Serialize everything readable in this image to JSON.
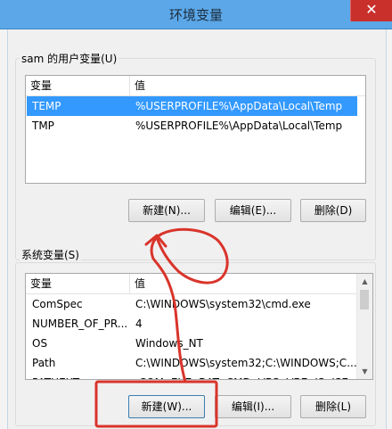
{
  "window": {
    "title": "环境变量",
    "close_glyph": "✕"
  },
  "user_vars": {
    "legend": "sam 的用户变量(U)",
    "columns": [
      "变量",
      "值"
    ],
    "rows": [
      {
        "name": "TEMP",
        "value": "%USERPROFILE%\\AppData\\Local\\Temp",
        "selected": true
      },
      {
        "name": "TMP",
        "value": "%USERPROFILE%\\AppData\\Local\\Temp",
        "selected": false
      }
    ],
    "buttons": {
      "new": "新建(N)...",
      "edit": "编辑(E)...",
      "delete": "删除(D)"
    }
  },
  "system_vars": {
    "legend": "系统变量(S)",
    "columns": [
      "变量",
      "值"
    ],
    "rows": [
      {
        "name": "ComSpec",
        "value": "C:\\WINDOWS\\system32\\cmd.exe"
      },
      {
        "name": "NUMBER_OF_PR...",
        "value": "4"
      },
      {
        "name": "OS",
        "value": "Windows_NT"
      },
      {
        "name": "Path",
        "value": "C:\\WINDOWS\\system32;C:\\WINDOWS;C..."
      },
      {
        "name": "PATHEXT",
        "value": ".COM;.EXE;.BAT;.CMD;.VBS;.VBE;.JS;.JSE;..."
      }
    ],
    "buttons": {
      "new": "新建(W)...",
      "edit": "编辑(I)...",
      "delete": "删除(L)"
    }
  },
  "colors": {
    "annotation": "#d9342b",
    "selection": "#3399ff",
    "titlebar": "#5ba7e8"
  }
}
